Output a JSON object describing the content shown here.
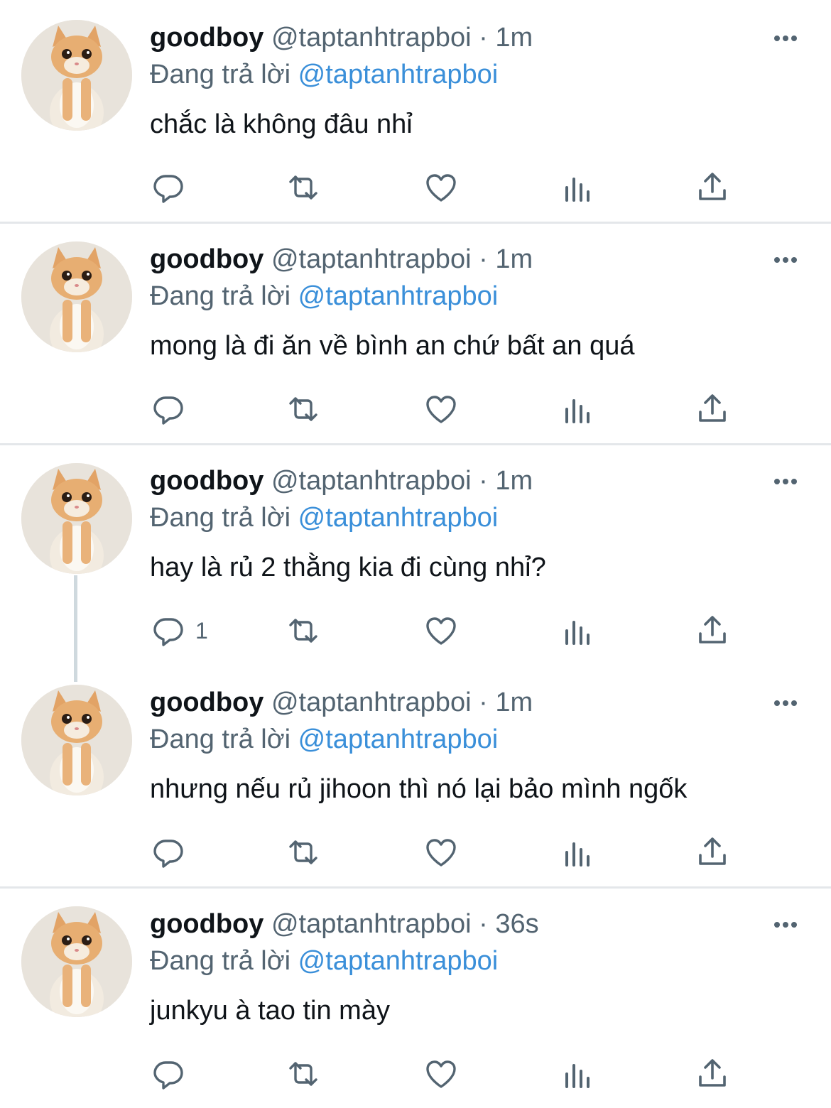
{
  "tweets": [
    {
      "name": "goodboy",
      "handle": "@taptanhtrapboi",
      "separator": "·",
      "time": "1m",
      "reply_prefix": "Đang trả lời",
      "reply_to": "@taptanhtrapboi",
      "text": "chắc là không đâu nhỉ",
      "reply_count": ""
    },
    {
      "name": "goodboy",
      "handle": "@taptanhtrapboi",
      "separator": "·",
      "time": "1m",
      "reply_prefix": "Đang trả lời",
      "reply_to": "@taptanhtrapboi",
      "text": "mong là đi ăn về bình an chứ bất an quá",
      "reply_count": ""
    },
    {
      "name": "goodboy",
      "handle": "@taptanhtrapboi",
      "separator": "·",
      "time": "1m",
      "reply_prefix": "Đang trả lời",
      "reply_to": "@taptanhtrapboi",
      "text": "hay là rủ 2 thằng kia đi cùng nhỉ?",
      "reply_count": "1"
    },
    {
      "name": "goodboy",
      "handle": "@taptanhtrapboi",
      "separator": "·",
      "time": "1m",
      "reply_prefix": "Đang trả lời",
      "reply_to": "@taptanhtrapboi",
      "text": "nhưng nếu rủ jihoon thì nó lại bảo mình ngốk",
      "reply_count": ""
    },
    {
      "name": "goodboy",
      "handle": "@taptanhtrapboi",
      "separator": "·",
      "time": "36s",
      "reply_prefix": "Đang trả lời",
      "reply_to": "@taptanhtrapboi",
      "text": "junkyu à tao tin mày",
      "reply_count": ""
    }
  ],
  "icons": {
    "reply": "reply-icon",
    "retweet": "retweet-icon",
    "like": "like-icon",
    "views": "views-icon",
    "share": "share-icon",
    "more": "more-icon",
    "avatar": "cat-avatar"
  },
  "colors": {
    "mention": "#3a8fd9",
    "secondary": "#536471",
    "divider": "#e4e7ea"
  }
}
